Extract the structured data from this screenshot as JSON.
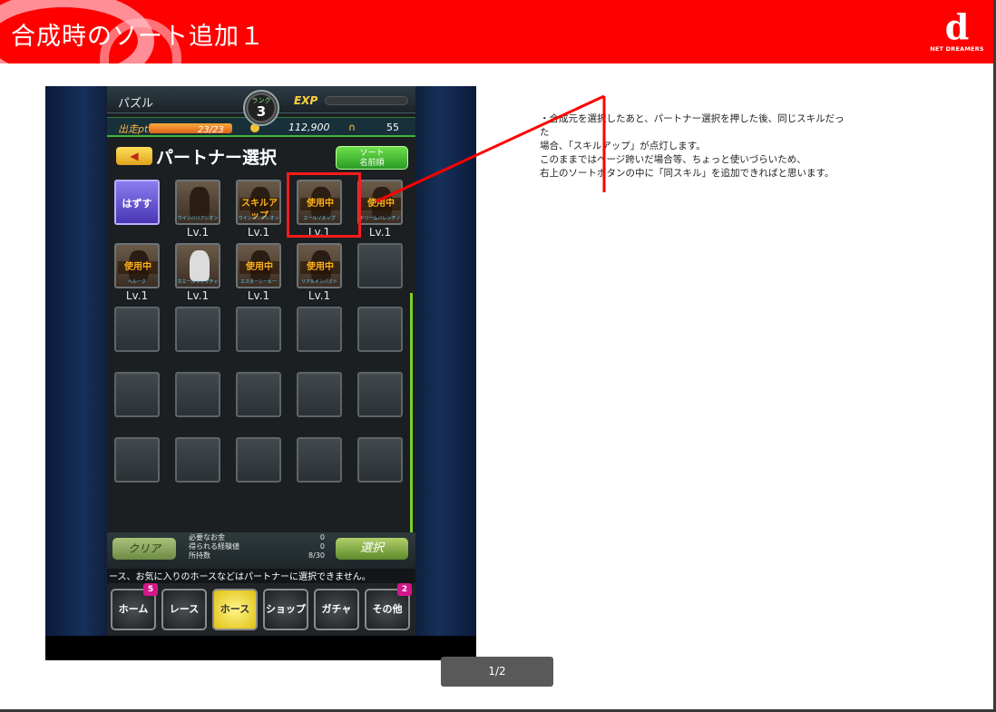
{
  "header": {
    "title": "合成時のソート追加１",
    "logo_mark": "d",
    "logo_text": "NET DREAMERS",
    "brand_color": "#ff0000"
  },
  "game": {
    "topbar": {
      "puzzle": "パズル",
      "exp_label": "EXP",
      "rank_label": "ランク",
      "rank_value": "3"
    },
    "status": {
      "sp_label": "出走pt",
      "sp_value": "23/23",
      "money": "112,900",
      "count": "55"
    },
    "title": "パートナー選択",
    "back_icon": "◀",
    "sort_button": {
      "line1": "ソート",
      "line2": "名前順"
    },
    "row1": [
      {
        "type": "unset",
        "text": "はずす",
        "lv": ""
      },
      {
        "type": "horse",
        "state": "",
        "name": "ウインバリアシオン",
        "lv": "Lv.1"
      },
      {
        "type": "horse",
        "state": "スキルアップ",
        "name": "ウインバリアシオン",
        "lv": "Lv.1"
      },
      {
        "type": "horse",
        "state": "使用中",
        "name": "エールソヌップ",
        "lv": "Lv.1"
      },
      {
        "type": "horse",
        "state": "使用中",
        "name": "ドリームバレンチノ",
        "lv": "Lv.1"
      }
    ],
    "row2": [
      {
        "type": "horse",
        "state": "使用中",
        "name": "ヘルーク",
        "lv": "Lv.1"
      },
      {
        "type": "horse_white",
        "state": "",
        "name": "ホエールキャプチャ",
        "lv": "Lv.1"
      },
      {
        "type": "horse",
        "state": "使用中",
        "name": "エスターシーヒー",
        "lv": "Lv.1"
      },
      {
        "type": "horse",
        "state": "使用中",
        "name": "リアルインパクト",
        "lv": "Lv.1"
      },
      {
        "type": "empty",
        "state": "",
        "name": "",
        "lv": ""
      }
    ],
    "bottom": {
      "clear": "クリア",
      "select": "選択",
      "stats": [
        {
          "label": "必要なお金",
          "value": "0"
        },
        {
          "label": "得られる経験値",
          "value": "0"
        },
        {
          "label": "所持数",
          "value": "8/30"
        }
      ]
    },
    "notice": "ース、お気に入りのホースなどはパートナーに選択できません。",
    "nav": [
      {
        "label": "ホーム",
        "badge": "5",
        "active": false
      },
      {
        "label": "レース",
        "badge": "",
        "active": false
      },
      {
        "label": "ホース",
        "badge": "",
        "active": true
      },
      {
        "label": "ショップ",
        "badge": "",
        "active": false
      },
      {
        "label": "ガチャ",
        "badge": "",
        "active": false
      },
      {
        "label": "その他",
        "badge": "2",
        "active": false
      }
    ]
  },
  "note": {
    "line1": "・合成元を選択したあと、パートナー選択を押した後、同じスキルだっ",
    "line2": "た",
    "line3": "場合、「スキルアップ」が点灯します。",
    "line4": "このままではページ跨いだ場合等、ちょっと使いづらいため、",
    "line5": "右上のソートボタンの中に「同スキル」を追加できればと思います。"
  },
  "pager": {
    "label": "1/2"
  }
}
